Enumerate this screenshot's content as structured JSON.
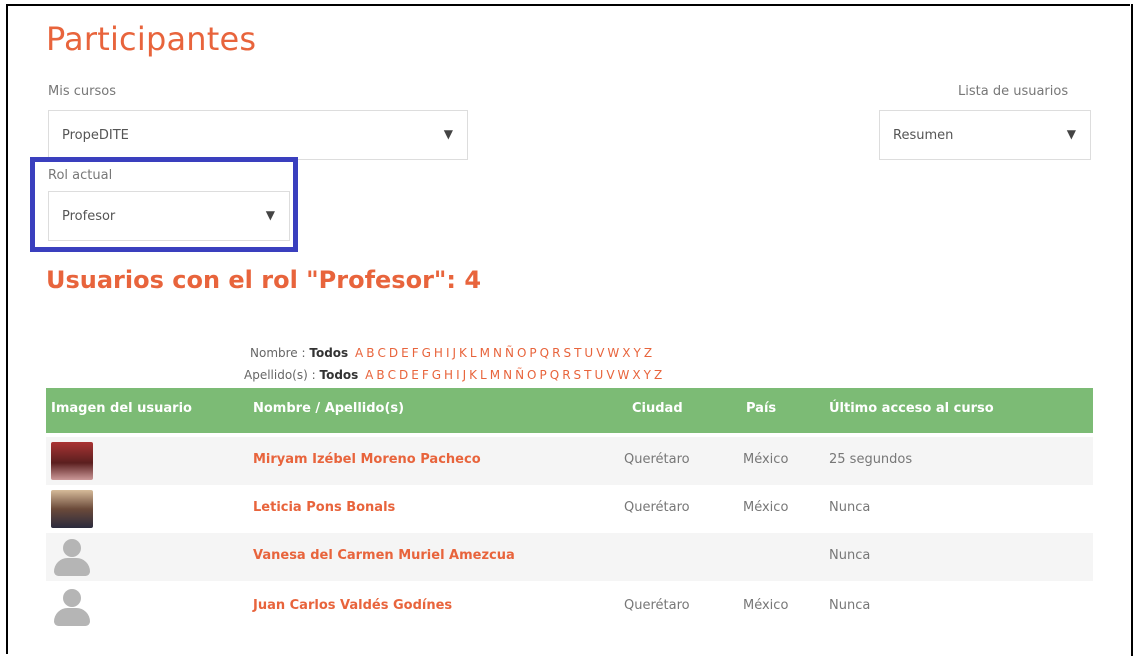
{
  "page": {
    "title": "Participantes"
  },
  "mis_cursos": {
    "label": "Mis cursos",
    "value": "PropeDITE"
  },
  "lista_usuarios": {
    "label": "Lista de usuarios",
    "value": "Resumen"
  },
  "rol_actual": {
    "label": "Rol actual",
    "value": "Profesor"
  },
  "role_heading": "Usuarios con el rol \"Profesor\": 4",
  "filters": {
    "first_name": {
      "label": "Nombre :",
      "all": "Todos",
      "letters": [
        "A",
        "B",
        "C",
        "D",
        "E",
        "F",
        "G",
        "H",
        "I",
        "J",
        "K",
        "L",
        "M",
        "N",
        "Ñ",
        "O",
        "P",
        "Q",
        "R",
        "S",
        "T",
        "U",
        "V",
        "W",
        "X",
        "Y",
        "Z"
      ]
    },
    "last_name": {
      "label": "Apellido(s) :",
      "all": "Todos",
      "letters": [
        "A",
        "B",
        "C",
        "D",
        "E",
        "F",
        "G",
        "H",
        "I",
        "J",
        "K",
        "L",
        "M",
        "N",
        "Ñ",
        "O",
        "P",
        "Q",
        "R",
        "S",
        "T",
        "U",
        "V",
        "W",
        "X",
        "Y",
        "Z"
      ]
    }
  },
  "table": {
    "headers": {
      "image": "Imagen del usuario",
      "name": "Nombre / Apellido(s)",
      "city": "Ciudad",
      "country": "País",
      "last_access": "Último acceso al curso"
    },
    "rows": [
      {
        "avatar": "photo",
        "name": "Miryam Izébel Moreno Pacheco",
        "city": "Querétaro",
        "country": "México",
        "last_access": "25 segundos"
      },
      {
        "avatar": "photo",
        "name": "Leticia Pons Bonals",
        "city": "Querétaro",
        "country": "México",
        "last_access": "Nunca"
      },
      {
        "avatar": "default-user-icon",
        "name": "Vanesa del Carmen Muriel Amezcua",
        "city": "",
        "country": "",
        "last_access": "Nunca"
      },
      {
        "avatar": "default-user-icon",
        "name": "Juan Carlos Valdés Godínes",
        "city": "Querétaro",
        "country": "México",
        "last_access": "Nunca"
      }
    ]
  },
  "colors": {
    "accent": "#e8643c",
    "header_bg": "#7cbb75",
    "highlight": "#3a3fbe"
  },
  "icons": {
    "dropdown": "▼"
  }
}
